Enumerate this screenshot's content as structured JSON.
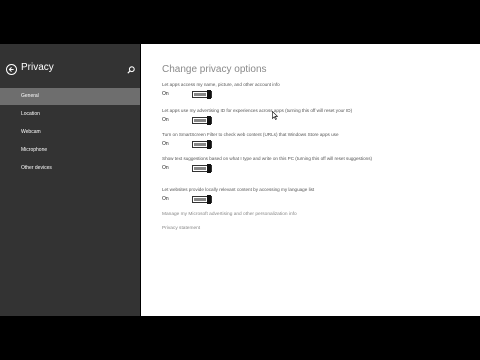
{
  "colors": {
    "sidebar": "#333333",
    "selected": "#6e6e6e",
    "content": "#ffffff",
    "accent": "#111111"
  },
  "sidebar": {
    "title": "Privacy",
    "back_icon": "back-arrow-icon",
    "search_icon": "search-icon",
    "items": [
      {
        "label": "General",
        "selected": true
      },
      {
        "label": "Location",
        "selected": false
      },
      {
        "label": "Webcam",
        "selected": false
      },
      {
        "label": "Microphone",
        "selected": false
      },
      {
        "label": "Other devices",
        "selected": false
      }
    ]
  },
  "main": {
    "title": "Change privacy options",
    "settings": [
      {
        "description": "Let apps access my name, picture, and other account info",
        "state": "On",
        "on": true
      },
      {
        "description": "Let apps use my advertising ID for experiences across apps (turning this off will reset your ID)",
        "state": "On",
        "on": true
      },
      {
        "description": "Turn on SmartScreen Filter to check web content (URLs) that Windows Store apps use",
        "state": "On",
        "on": true
      },
      {
        "description": "Show text suggestions based on what I type and write on this PC (turning this off will reset suggestions)",
        "state": "On",
        "on": true
      },
      {
        "description": "Let websites provide locally relevant content by accessing my language list",
        "state": "On",
        "on": true
      }
    ],
    "links": {
      "manage": "Manage my Microsoft advertising and other personalization info",
      "privacy_statement": "Privacy statement"
    }
  }
}
